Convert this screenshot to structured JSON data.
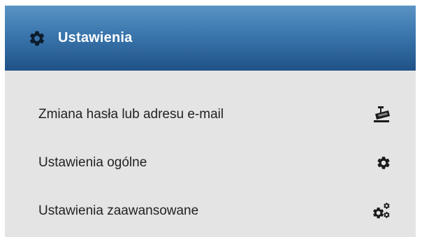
{
  "panel": {
    "title": "Ustawienia",
    "title_icon": "gear-icon",
    "header_color": "#2f679e"
  },
  "menu": {
    "items": [
      {
        "label": "Zmiana hasła lub adresu e-mail",
        "icon": "camera-icon"
      },
      {
        "label": "Ustawienia ogólne",
        "icon": "gear-icon"
      },
      {
        "label": "Ustawienia zaawansowane",
        "icon": "gears-icon"
      }
    ]
  }
}
